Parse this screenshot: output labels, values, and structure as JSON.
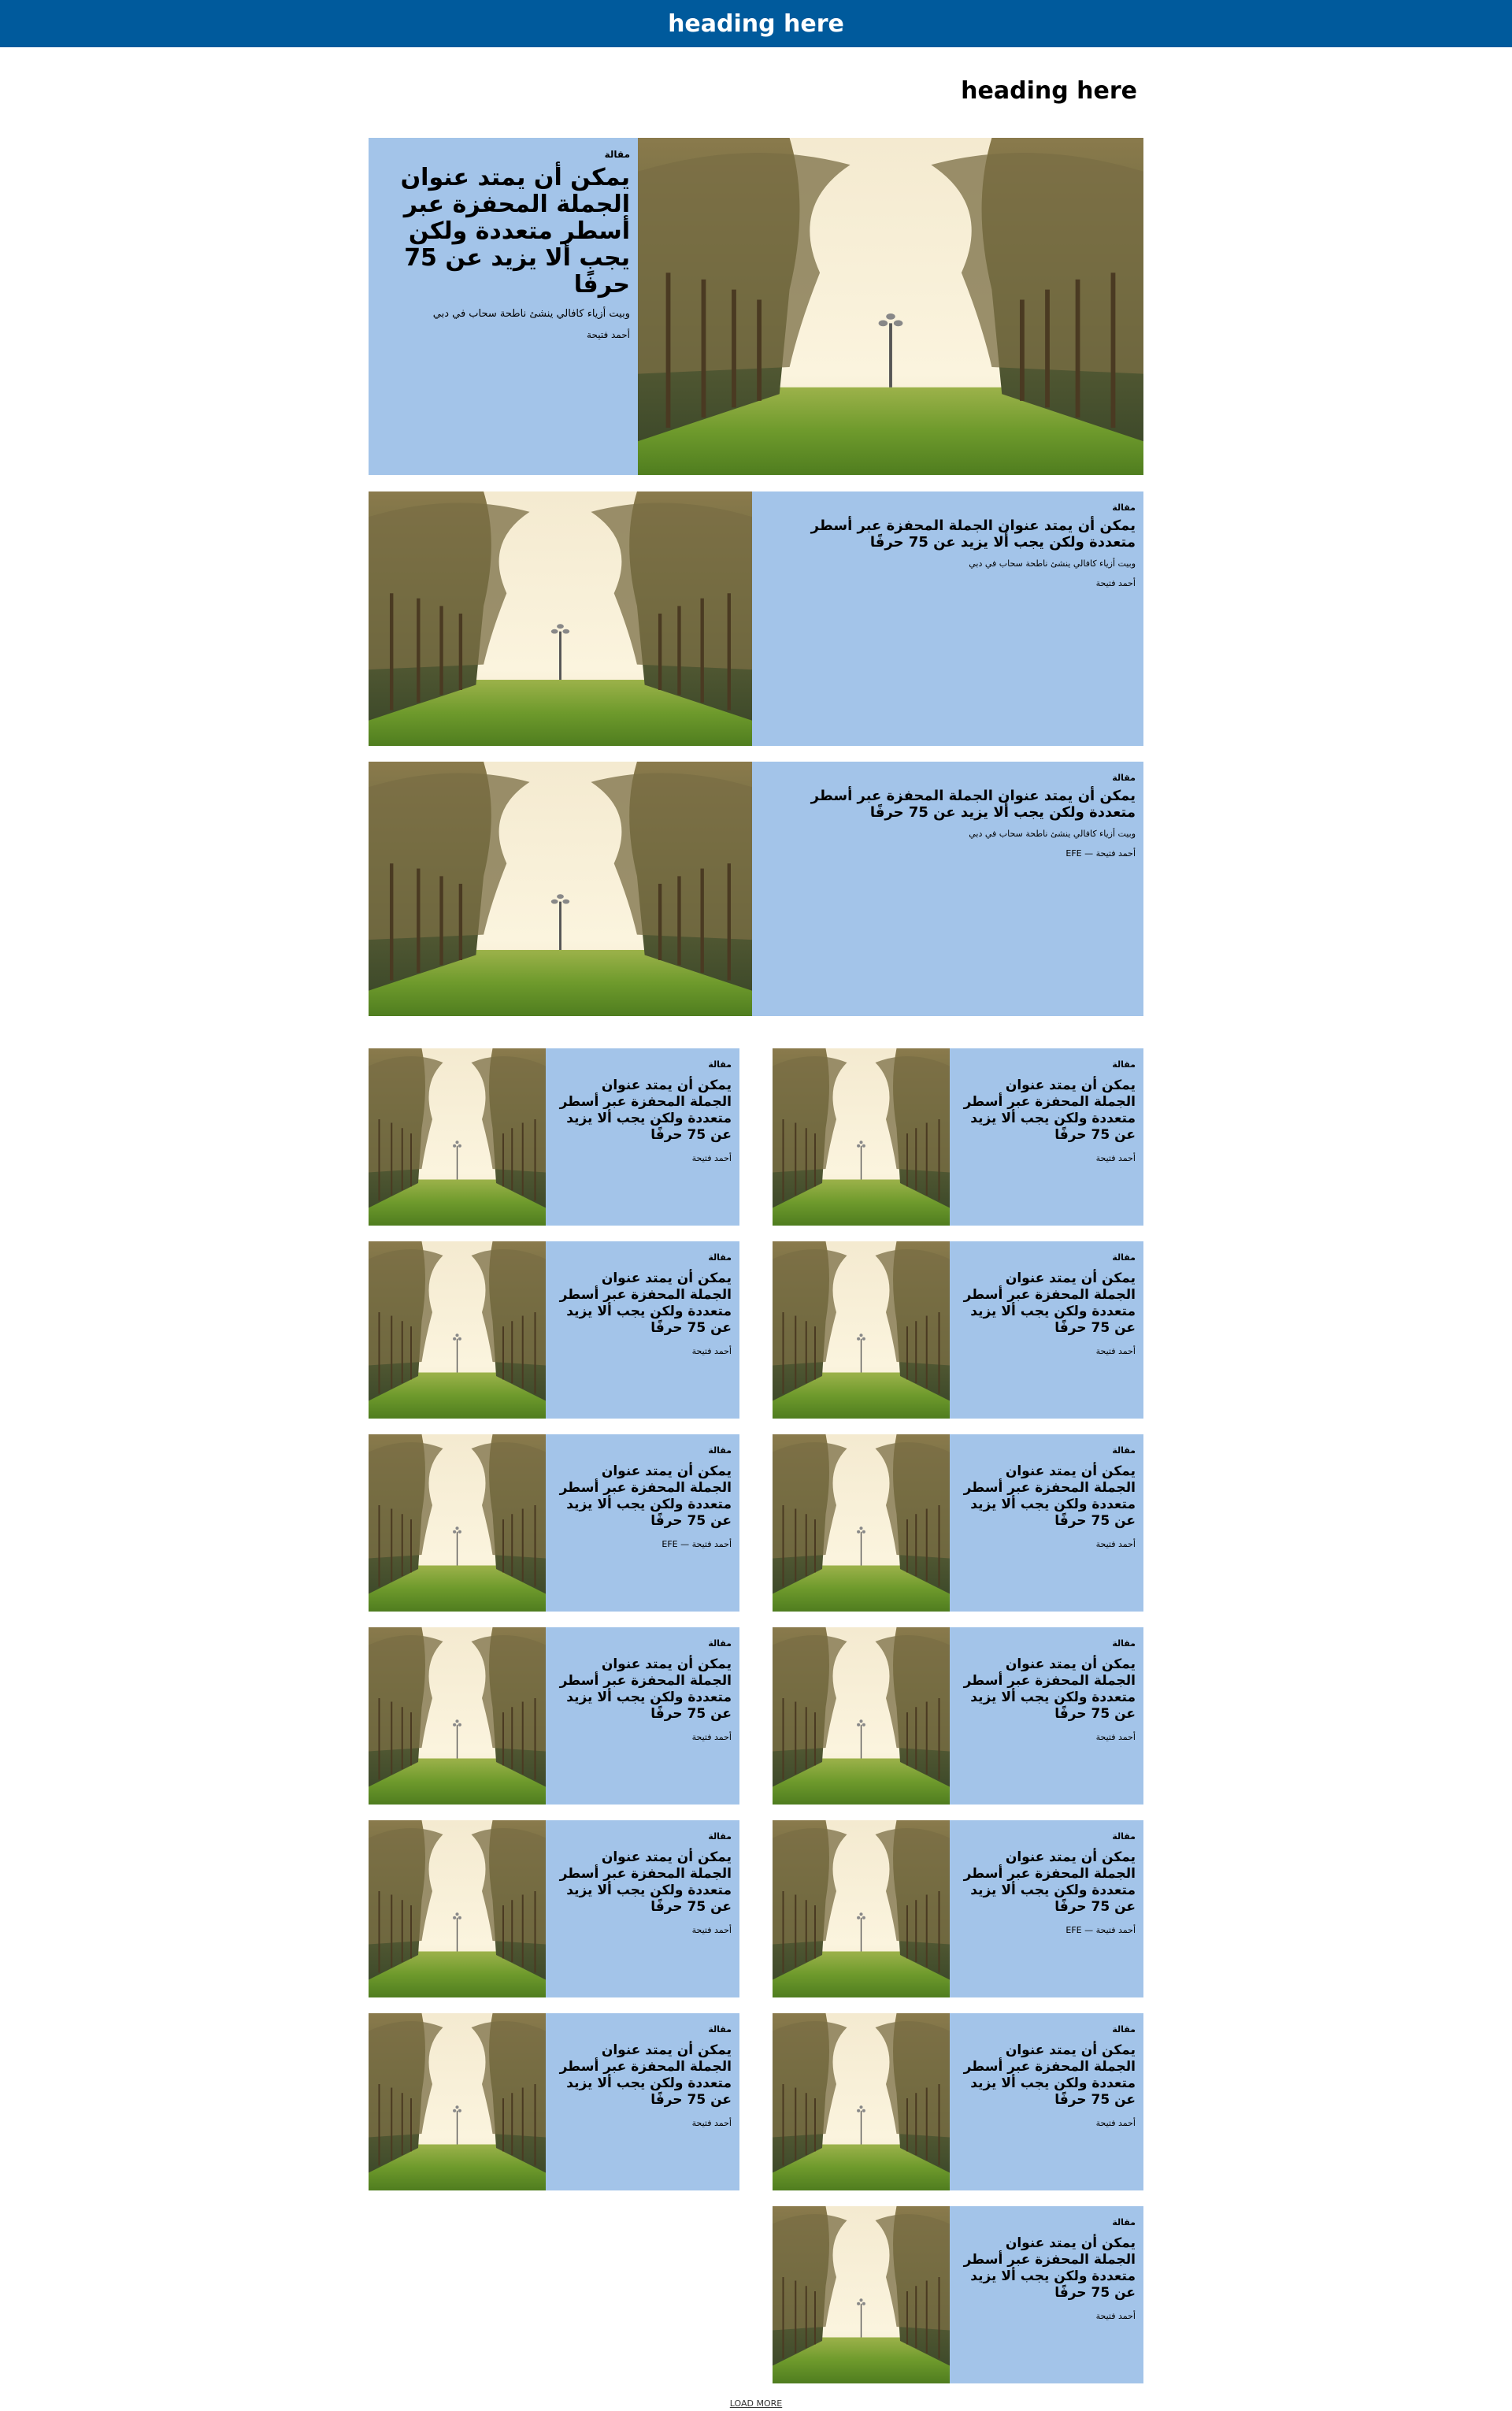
{
  "header": {
    "title": "heading here"
  },
  "section": {
    "heading": "heading here"
  },
  "colors": {
    "header_bg": "#005a9c",
    "card_bg": "#a3c4e9"
  },
  "hero": {
    "category": "مقالة",
    "title": "يمكن أن يمتد عنوان الجملة المحفزة عبر أسطر متعددة ولكن يجب ألا يزيد عن 75 حرفًا",
    "subtitle": "وبيت أزياء كافالي ينشئ ناطحة سحاب في دبي",
    "author": "أحمد فتيحة"
  },
  "medium_cards": [
    {
      "category": "مقالة",
      "title": "يمكن أن يمتد عنوان الجملة المحفزة عبر أسطر متعددة ولكن يجب ألا يزيد عن 75 حرفًا",
      "subtitle": "وبيت أزياء كافالي ينشئ ناطحة سحاب في دبي",
      "author": "أحمد فتيحة"
    },
    {
      "category": "مقالة",
      "title": "يمكن أن يمتد عنوان الجملة المحفزة عبر أسطر متعددة ولكن يجب ألا يزيد عن 75 حرفًا",
      "subtitle": "وبيت أزياء كافالي ينشئ ناطحة سحاب في دبي",
      "author": "أحمد فتيحة — EFE"
    }
  ],
  "small_cards": [
    {
      "category": "مقالة",
      "title": "يمكن أن يمتد عنوان الجملة المحفزة عبر أسطر متعددة ولكن يجب ألا يزيد عن 75 حرفًا",
      "author": "أحمد فتيحة"
    },
    {
      "category": "مقالة",
      "title": "يمكن أن يمتد عنوان الجملة المحفزة عبر أسطر متعددة ولكن يجب ألا يزيد عن 75 حرفًا",
      "author": "أحمد فتيحة"
    },
    {
      "category": "مقالة",
      "title": "يمكن أن يمتد عنوان الجملة المحفزة عبر أسطر متعددة ولكن يجب ألا يزيد عن 75 حرفًا",
      "author": "أحمد فتيحة"
    },
    {
      "category": "مقالة",
      "title": "يمكن أن يمتد عنوان الجملة المحفزة عبر أسطر متعددة ولكن يجب ألا يزيد عن 75 حرفًا",
      "author": "أحمد فتيحة"
    },
    {
      "category": "مقالة",
      "title": "يمكن أن يمتد عنوان الجملة المحفزة عبر أسطر متعددة ولكن يجب ألا يزيد عن 75 حرفًا",
      "author": "أحمد فتيحة"
    },
    {
      "category": "مقالة",
      "title": "يمكن أن يمتد عنوان الجملة المحفزة عبر أسطر متعددة ولكن يجب ألا يزيد عن 75 حرفًا",
      "author": "أحمد فتيحة — EFE"
    },
    {
      "category": "مقالة",
      "title": "يمكن أن يمتد عنوان الجملة المحفزة عبر أسطر متعددة ولكن يجب ألا يزيد عن 75 حرفًا",
      "author": "أحمد فتيحة"
    },
    {
      "category": "مقالة",
      "title": "يمكن أن يمتد عنوان الجملة المحفزة عبر أسطر متعددة ولكن يجب ألا يزيد عن 75 حرفًا",
      "author": "أحمد فتيحة"
    },
    {
      "category": "مقالة",
      "title": "يمكن أن يمتد عنوان الجملة المحفزة عبر أسطر متعددة ولكن يجب ألا يزيد عن 75 حرفًا",
      "author": "أحمد فتيحة — EFE"
    },
    {
      "category": "مقالة",
      "title": "يمكن أن يمتد عنوان الجملة المحفزة عبر أسطر متعددة ولكن يجب ألا يزيد عن 75 حرفًا",
      "author": "أحمد فتيحة"
    },
    {
      "category": "مقالة",
      "title": "يمكن أن يمتد عنوان الجملة المحفزة عبر أسطر متعددة ولكن يجب ألا يزيد عن 75 حرفًا",
      "author": "أحمد فتيحة"
    },
    {
      "category": "مقالة",
      "title": "يمكن أن يمتد عنوان الجملة المحفزة عبر أسطر متعددة ولكن يجب ألا يزيد عن 75 حرفًا",
      "author": "أحمد فتيحة"
    },
    {
      "category": "مقالة",
      "title": "يمكن أن يمتد عنوان الجملة المحفزة عبر أسطر متعددة ولكن يجب ألا يزيد عن 75 حرفًا",
      "author": "أحمد فتيحة"
    }
  ],
  "load_more_label": "LOAD MORE"
}
